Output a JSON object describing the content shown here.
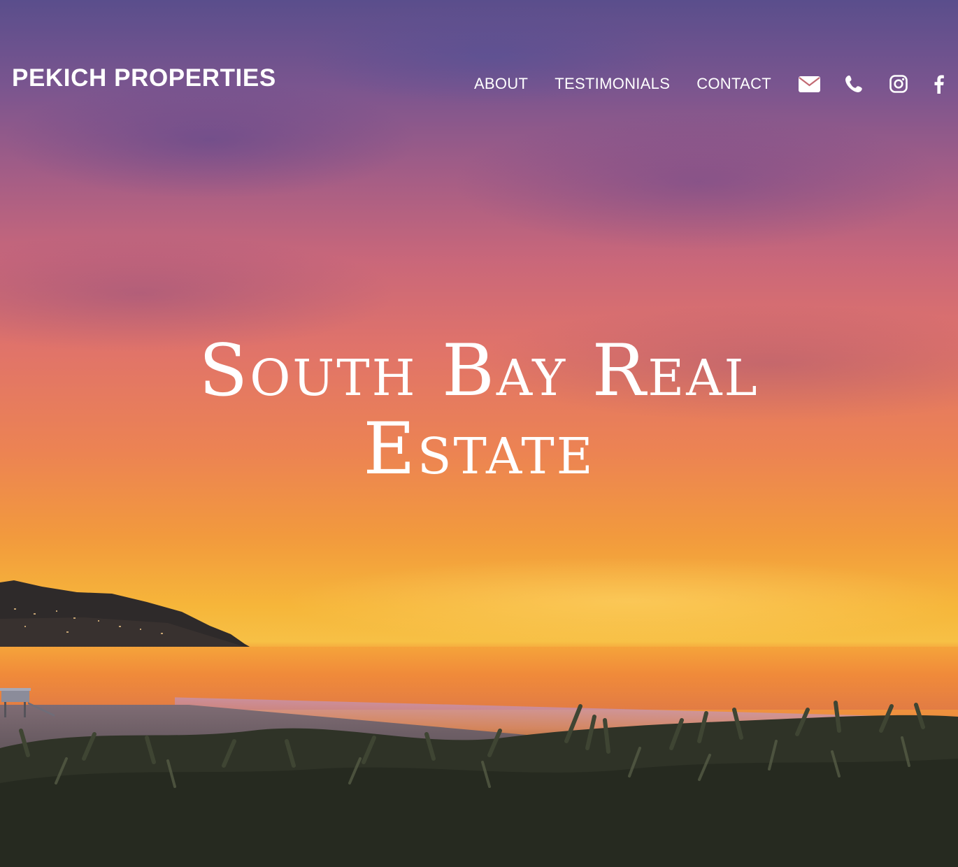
{
  "header": {
    "brand": "PEKICH PROPERTIES",
    "nav": [
      {
        "label": "ABOUT"
      },
      {
        "label": "TESTIMONIALS"
      },
      {
        "label": "CONTACT"
      }
    ],
    "icons": [
      "envelope-icon",
      "phone-icon",
      "instagram-icon",
      "facebook-icon"
    ]
  },
  "hero": {
    "headline": "South Bay Real Estate"
  },
  "colors": {
    "text": "#ffffff",
    "sky_top": "#5a4e8c",
    "sky_mid": "#e0736a",
    "horizon": "#f7c045"
  }
}
